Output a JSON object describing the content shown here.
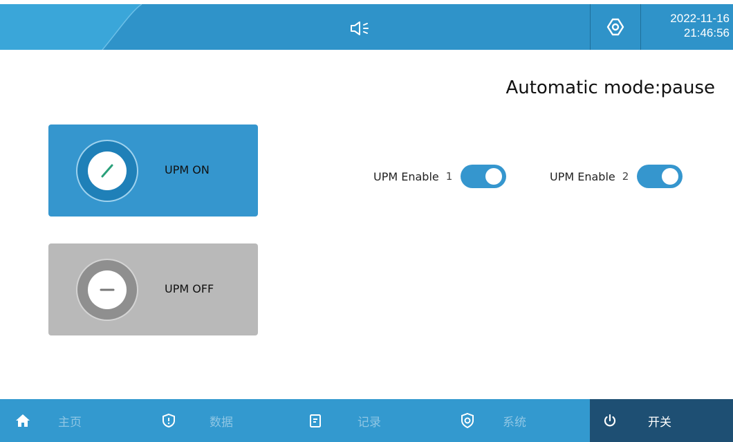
{
  "header": {
    "speaker_icon": "speaker-volume-icon",
    "settings_icon": "gear-icon",
    "date": "2022-11-16",
    "time": "21:46:56"
  },
  "status": {
    "mode_text": "Automatic mode:pause"
  },
  "cards": {
    "on": {
      "label": "UPM ON",
      "icon": "check-circle-icon",
      "color": "#3596ce"
    },
    "off": {
      "label": "UPM OFF",
      "icon": "minus-circle-icon",
      "color": "#b9b9b9"
    }
  },
  "enables": [
    {
      "label": "UPM Enable",
      "number": "1",
      "enabled": true
    },
    {
      "label": "UPM Enable",
      "number": "2",
      "enabled": true
    }
  ],
  "nav": {
    "items": [
      {
        "label": "主页",
        "icon": "home-icon",
        "active": false
      },
      {
        "label": "数据",
        "icon": "shield-alert-icon",
        "active": false
      },
      {
        "label": "记录",
        "icon": "document-icon",
        "active": false
      },
      {
        "label": "系统",
        "icon": "gear-shield-icon",
        "active": false
      },
      {
        "label": "开关",
        "icon": "power-icon",
        "active": true
      }
    ]
  },
  "colors": {
    "accent": "#3399cf",
    "header": "#2f93c9",
    "active_nav": "#1e4f73"
  }
}
